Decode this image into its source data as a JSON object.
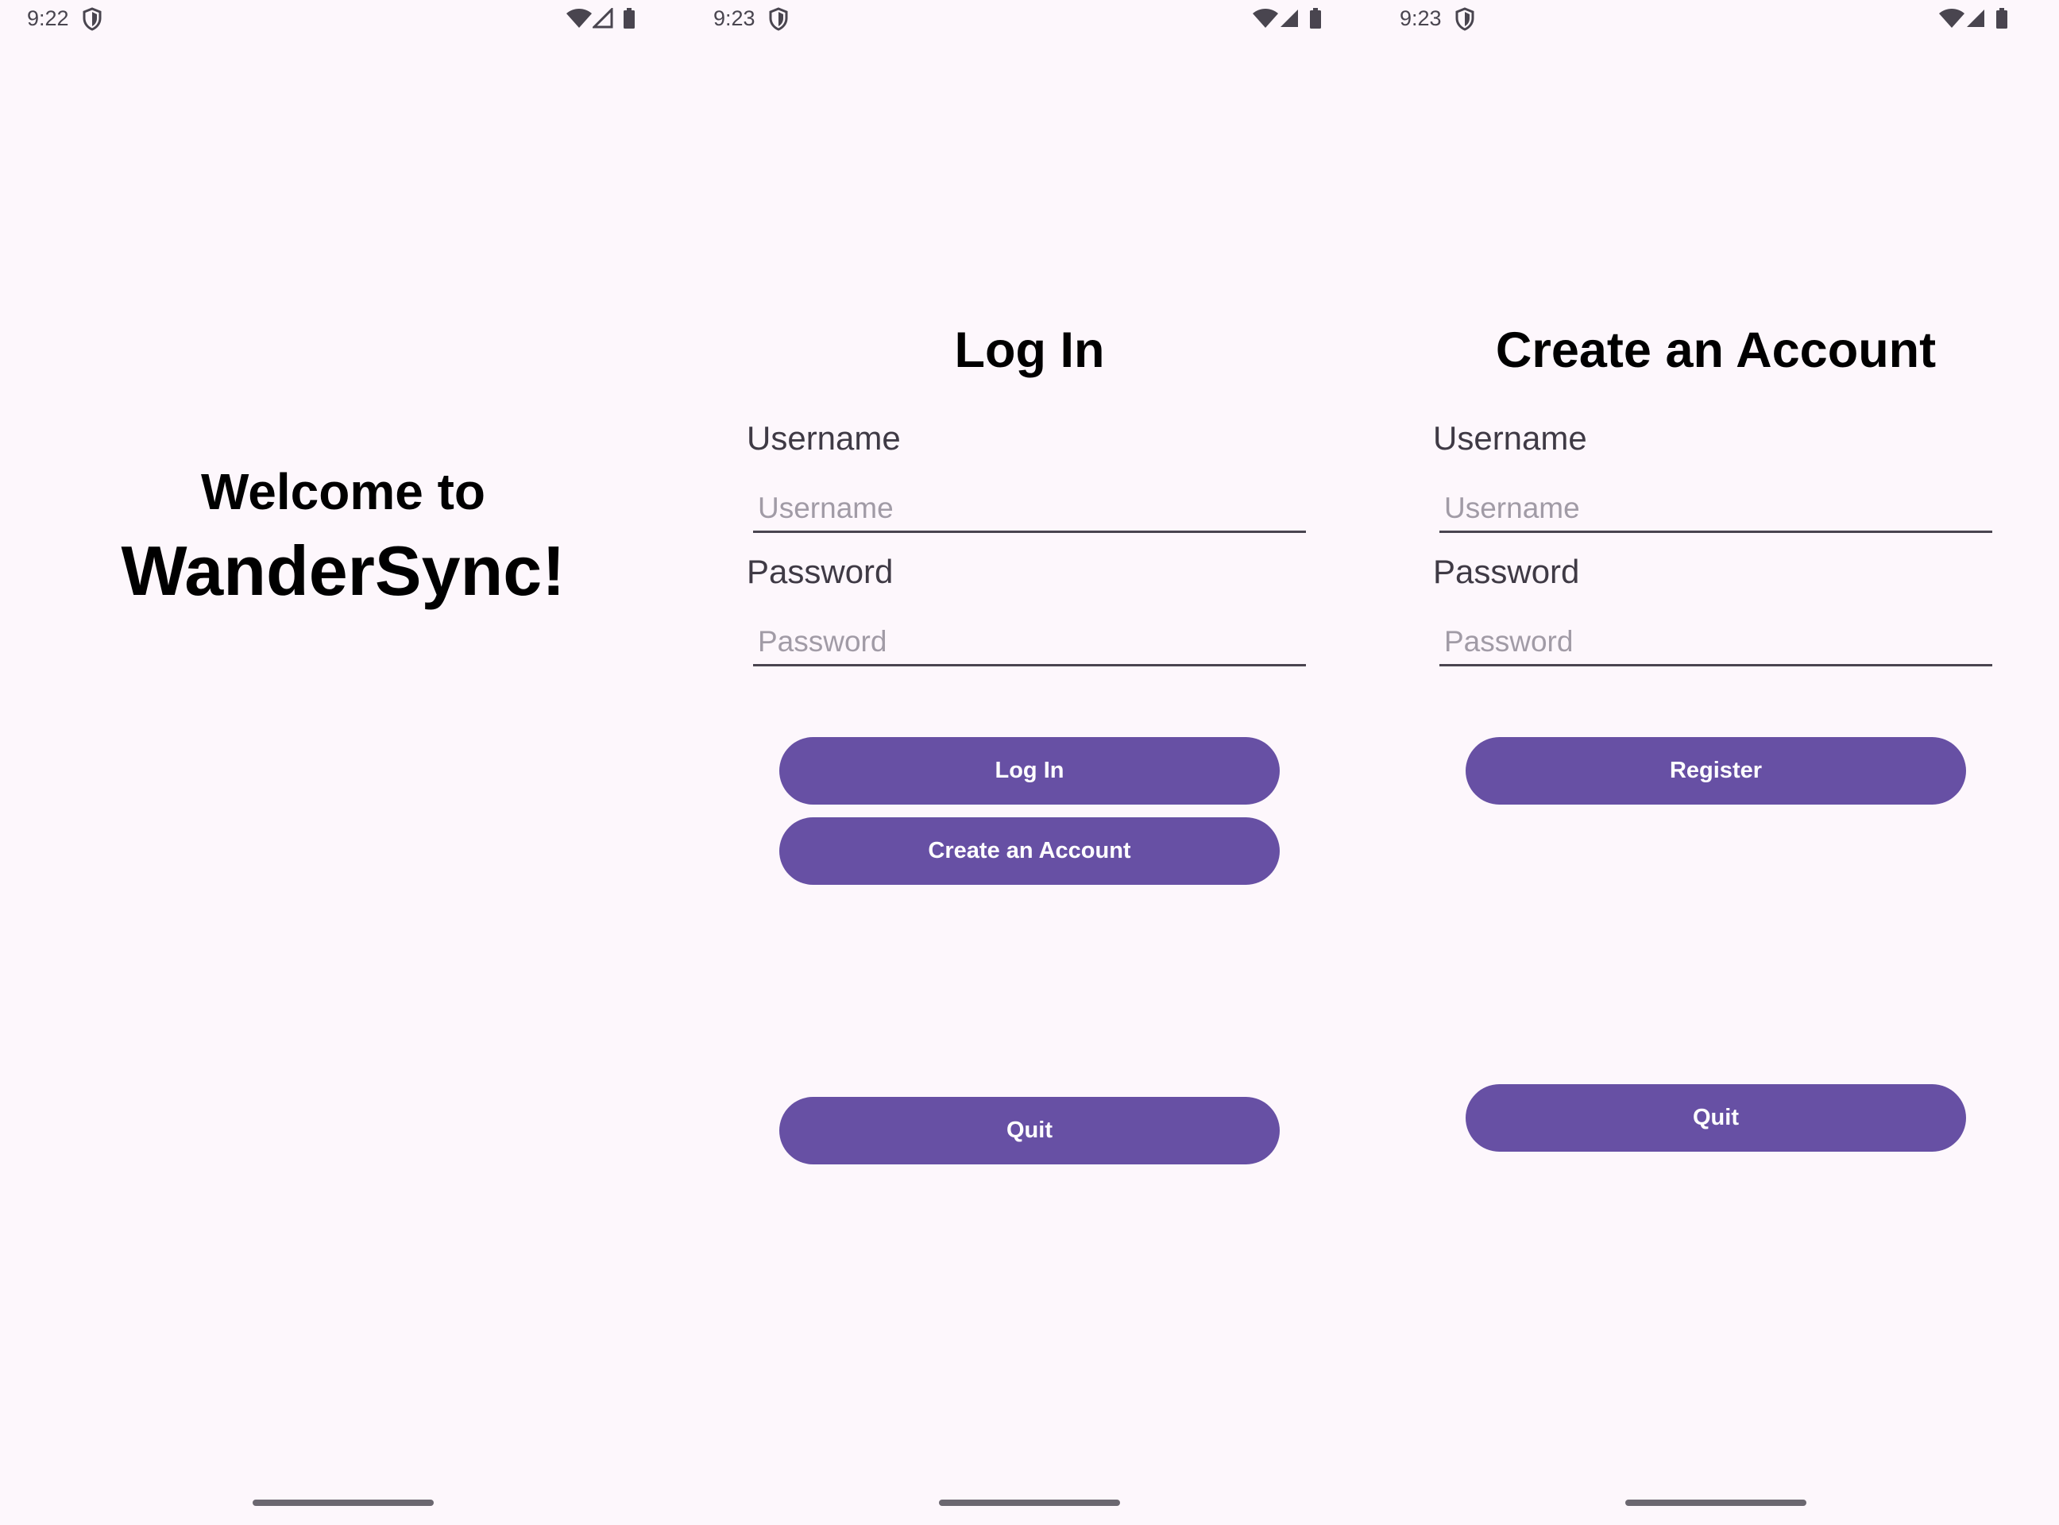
{
  "colors": {
    "background": "#FDF7FC",
    "button": "#6750A4",
    "button_text": "#FFFFFF"
  },
  "welcome_screen": {
    "status_time": "9:22",
    "line1": "Welcome to",
    "line2": "WanderSync!"
  },
  "login_screen": {
    "status_time": "9:23",
    "title": "Log In",
    "username_label": "Username",
    "username_placeholder": "Username",
    "password_label": "Password",
    "password_placeholder": "Password",
    "login_button": "Log In",
    "create_account_button": "Create an Account",
    "quit_button": "Quit"
  },
  "register_screen": {
    "status_time": "9:23",
    "title": "Create an Account",
    "username_label": "Username",
    "username_placeholder": "Username",
    "password_label": "Password",
    "password_placeholder": "Password",
    "register_button": "Register",
    "quit_button": "Quit"
  },
  "status_icons": [
    "shield-icon",
    "wifi-icon",
    "cellular-signal-icon",
    "battery-icon"
  ]
}
